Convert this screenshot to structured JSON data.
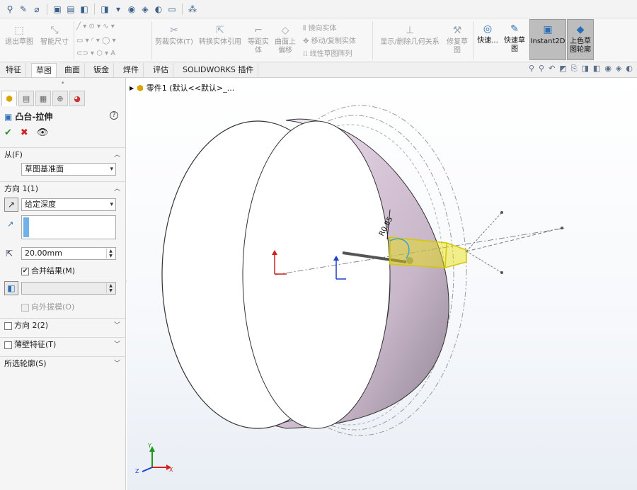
{
  "ribbon": {
    "exit_sketch": "退出草图",
    "smart_dim": "智能尺寸",
    "trim": "剪裁实体(T)",
    "convert": "转换实体引用",
    "offset_1": "等距实",
    "offset_2": "体",
    "offset_surf_1": "曲面上",
    "offset_surf_2": "偏移",
    "mirror": "镜向实体",
    "move_copy": "移动/复制实体",
    "linear_pattern": "线性草图阵列",
    "show_relations": "显示/删除几何关系",
    "repair_1": "修复草",
    "repair_2": "图",
    "quick_snap": "快速...",
    "rapid_sketch_1": "快速草",
    "rapid_sketch_2": "图",
    "instant2d": "Instant2D",
    "shaded_1": "上色草",
    "shaded_2": "图轮廓"
  },
  "tabs": [
    "特征",
    "草图",
    "曲面",
    "钣金",
    "焊件",
    "评估",
    "SOLIDWORKS 插件"
  ],
  "property_manager": {
    "title": "凸台-拉伸",
    "from_label": "从(F)",
    "from_value": "草图基准面",
    "dir1_label": "方向 1(1)",
    "dir1_type": "给定深度",
    "depth_value": "20.00mm",
    "merge_label": "合并结果(M)",
    "draft_label": "向外拔模(O)",
    "dir2_label": "方向 2(2)",
    "thin_label": "薄壁特征(T)",
    "contours_label": "所选轮廓(S)"
  },
  "tree": {
    "part": "零件1 (默认<<默认>_..."
  },
  "dimension": {
    "label": "R0.85"
  },
  "colors": {
    "accent": "#2a6fb6",
    "ok": "#2e8b2e",
    "cancel": "#cc2222",
    "preview": "#e8e000"
  }
}
